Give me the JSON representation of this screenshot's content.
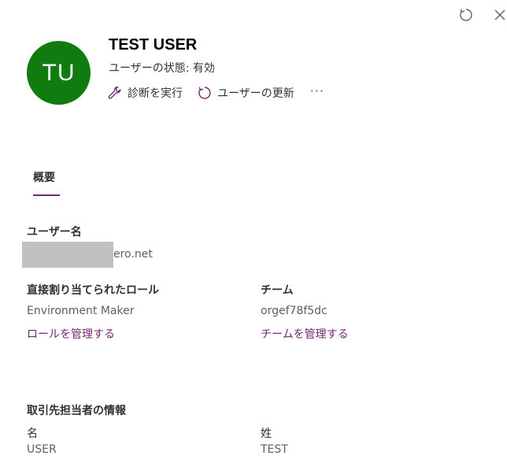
{
  "header": {
    "avatar_initials": "TU",
    "avatar_color": "#107c10",
    "user_name": "TEST USER",
    "status": "ユーザーの状態: 有効",
    "actions": {
      "diagnose": "診断を実行",
      "update_user": "ユーザーの更新",
      "more": "···"
    }
  },
  "tabs": {
    "overview": "概要"
  },
  "username_section": {
    "label": "ユーザー名",
    "value_visible": "ero.net"
  },
  "roles_section": {
    "label": "直接割り当てられたロール",
    "value": "Environment Maker",
    "manage_link": "ロールを管理する"
  },
  "team_section": {
    "label": "チーム",
    "value": "orgef78f5dc",
    "manage_link": "チームを管理する"
  },
  "contact_section": {
    "label": "取引先担当者の情報",
    "first_name_label": "名",
    "first_name_value": "USER",
    "last_name_label": "姓",
    "last_name_value": "TEST"
  },
  "colors": {
    "accent": "#742774"
  },
  "icons": {
    "top_refresh": "refresh-icon",
    "top_close": "close-icon",
    "diagnose": "wrench-icon",
    "update": "refresh-icon"
  }
}
